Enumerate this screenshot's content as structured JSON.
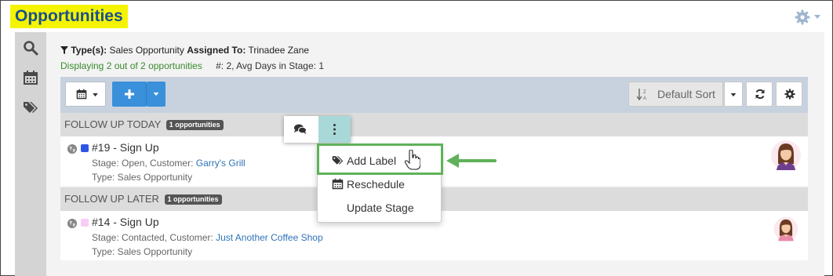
{
  "page": {
    "title": "Opportunities"
  },
  "filters": {
    "types_label": "Type(s):",
    "types_value": "Sales Opportunity",
    "assigned_label": "Assigned To:",
    "assigned_value": "Trinadee Zane",
    "displaying": "Displaying 2 out of 2 opportunities",
    "stats": "#: 2, Avg Days in Stage: 1"
  },
  "toolbar": {
    "sort_label": "Default Sort"
  },
  "groups": [
    {
      "label": "FOLLOW UP TODAY",
      "badge": "1 opportunities",
      "item": {
        "title": "#19 - Sign Up",
        "stage_prefix": "Stage: Open, Customer: ",
        "customer": "Garry's Grill",
        "type": "Type: Sales Opportunity",
        "swatch_color": "#2f55e8"
      }
    },
    {
      "label": "FOLLOW UP LATER",
      "badge": "1 opportunities",
      "item": {
        "title": "#14 - Sign Up",
        "stage_prefix": "Stage: Contacted, Customer: ",
        "customer": "Just Another Coffee Shop",
        "type": "Type: Sales Opportunity",
        "swatch_color": "#f7cdf3"
      }
    }
  ],
  "context_menu": {
    "items": [
      {
        "label": "Add Label",
        "icon": "tags-icon"
      },
      {
        "label": "Reschedule",
        "icon": "calendar-icon"
      },
      {
        "label": "Update Stage",
        "icon": ""
      }
    ]
  },
  "colors": {
    "title_highlight": "#f4f400",
    "title_text": "#1a4f8f",
    "primary_button": "#3a90db",
    "annotation_green": "#5fb25a",
    "link": "#2e73b8"
  }
}
